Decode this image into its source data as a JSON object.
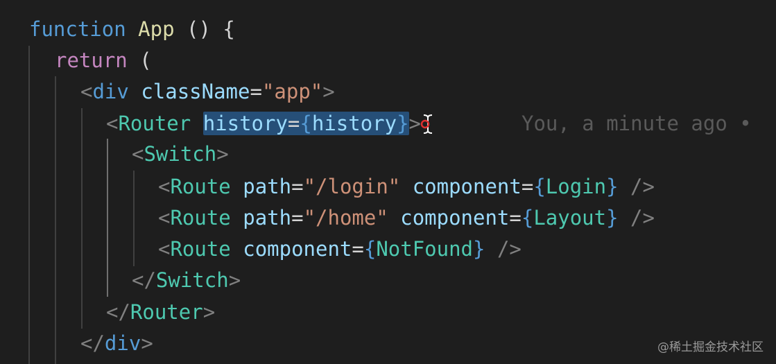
{
  "code": {
    "line1": {
      "kw": "function",
      "name": "App",
      "rest": " () {"
    },
    "line2": {
      "kw": "return",
      "rest": " ("
    },
    "line3": {
      "open": "<",
      "tag": "div",
      "attr": "className",
      "eq": "=",
      "str": "\"app\"",
      "close": ">"
    },
    "line4": {
      "open": "<",
      "tag": "Router",
      "attr": "history",
      "eq": "=",
      "lb": "{",
      "val": "history",
      "rb": "}",
      "close": ">"
    },
    "line5": {
      "open": "<",
      "tag": "Switch",
      "close": ">"
    },
    "line6": {
      "open": "<",
      "tag": "Route",
      "attr1": "path",
      "eq1": "=",
      "str": "\"/login\"",
      "attr2": "component",
      "eq2": "=",
      "lb": "{",
      "val": "Login",
      "rb": "}",
      "close": " />"
    },
    "line7": {
      "open": "<",
      "tag": "Route",
      "attr1": "path",
      "eq1": "=",
      "str": "\"/home\"",
      "attr2": "component",
      "eq2": "=",
      "lb": "{",
      "val": "Layout",
      "rb": "}",
      "close": " />"
    },
    "line8": {
      "open": "<",
      "tag": "Route",
      "attr2": "component",
      "eq2": "=",
      "lb": "{",
      "val": "NotFound",
      "rb": "}",
      "close": " />"
    },
    "line9": {
      "open": "</",
      "tag": "Switch",
      "close": ">"
    },
    "line10": {
      "open": "</",
      "tag": "Router",
      "close": ">"
    },
    "line11": {
      "open": "</",
      "tag": "div",
      "close": ">"
    }
  },
  "blame": "You, a minute ago •",
  "watermark": "@稀土掘金技术社区",
  "colors": {
    "background": "#1e1e1e",
    "keyword": "#569cd6",
    "control": "#c586c0",
    "function": "#dcdcaa",
    "component": "#4ec9b0",
    "attribute": "#9cdcfe",
    "string": "#ce9178",
    "selection": "#264f78"
  },
  "icons": {
    "cursor": "text-cursor-icon"
  }
}
